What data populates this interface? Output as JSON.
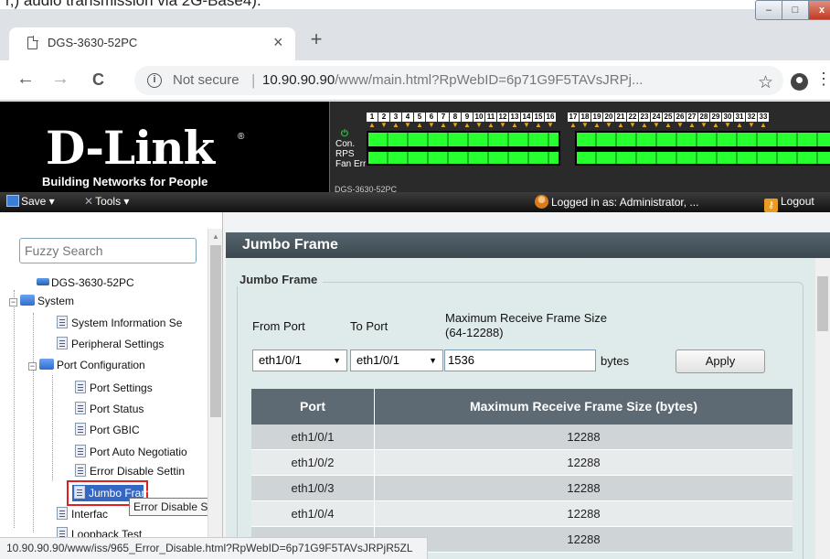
{
  "page_top_text": "r,) audio transmission via 2G-Base4).",
  "browser": {
    "tab_title": "DGS-3630-52PC",
    "tab_close": "×",
    "new_tab": "+",
    "win_min": "–",
    "win_max": "□",
    "win_close": "x",
    "back": "←",
    "forward": "→",
    "reload": "C",
    "info": "i",
    "security": "Not secure",
    "separator": "|",
    "url_host": "10.90.90.90",
    "url_path": "/www/main.html?RpWebID=6p71G9F5TAVsJRPj...",
    "bookmark": "☆",
    "menu": "⋮"
  },
  "banner": {
    "logo": "D-Link",
    "reg_mark": "®",
    "tagline": "Building Networks for People",
    "leds": {
      "power": "⏻",
      "con": "Con.",
      "rps": "RPS",
      "fan": "Fan",
      "err": "Err"
    },
    "port_numbers_a": [
      "1",
      "2",
      "3",
      "4",
      "5",
      "6",
      "7",
      "8",
      "9",
      "10",
      "11",
      "12",
      "13",
      "14",
      "15",
      "16"
    ],
    "port_numbers_b": [
      "17",
      "18",
      "19",
      "20",
      "21",
      "22",
      "23",
      "24",
      "25",
      "26",
      "27",
      "28",
      "29",
      "30",
      "31",
      "32",
      "33"
    ],
    "device_label": "DGS-3630-52PC"
  },
  "toolbar": {
    "save": "Save ▾",
    "tools": "Tools ▾",
    "logged_in": "Logged in as: Administrator, ...",
    "logout": "Logout"
  },
  "tree": {
    "search_placeholder": "Fuzzy Search",
    "items": [
      "DGS-3630-52PC",
      "System",
      "System Information Se",
      "Peripheral Settings",
      "Port Configuration",
      "Port Settings",
      "Port Status",
      "Port GBIC",
      "Port Auto Negotiatio",
      "Error Disable Settin",
      "Jumbo Frame",
      "Interfac",
      "Loopback Test"
    ],
    "tooltip": "Error Disable Settings"
  },
  "content": {
    "header": "Jumbo Frame",
    "legend": "Jumbo Frame",
    "from_port_label": "From Port",
    "to_port_label": "To Port",
    "max_label_1": "Maximum Receive Frame Size",
    "max_label_2": "(64-12288)",
    "from_port_value": "eth1/0/1",
    "to_port_value": "eth1/0/1",
    "size_value": "1536",
    "bytes_label": "bytes",
    "apply": "Apply",
    "table": {
      "headers": [
        "Port",
        "Maximum Receive Frame Size (bytes)"
      ],
      "rows": [
        [
          "eth1/0/1",
          "12288"
        ],
        [
          "eth1/0/2",
          "12288"
        ],
        [
          "eth1/0/3",
          "12288"
        ],
        [
          "eth1/0/4",
          "12288"
        ],
        [
          "",
          "12288"
        ]
      ]
    }
  },
  "statusbar": "10.90.90.90/www/iss/965_Error_Disable.html?RpWebID=6p71G9F5TAVsJRPjR5ZL"
}
